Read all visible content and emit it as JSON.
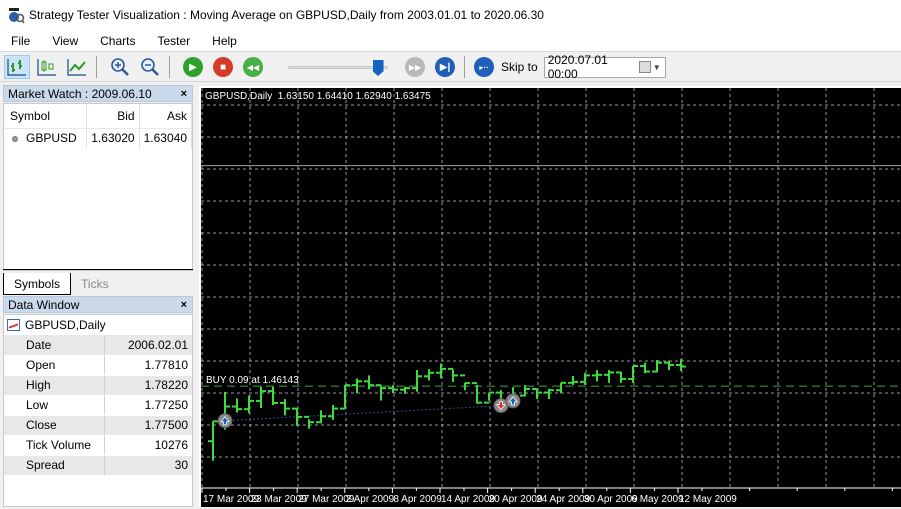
{
  "window": {
    "title": "Strategy Tester Visualization : Moving Average on GBPUSD,Daily from 2003.01.01 to 2020.06.30"
  },
  "menu": [
    {
      "label": "File"
    },
    {
      "label": "View"
    },
    {
      "label": "Charts"
    },
    {
      "label": "Tester"
    },
    {
      "label": "Help"
    }
  ],
  "toolbar": {
    "icons": [
      "bar-chart-icon",
      "candlestick-chart-icon",
      "line-chart-icon",
      "zoom-in-icon",
      "zoom-out-icon",
      "play-icon",
      "stop-icon",
      "rewind-icon",
      "fast-forward-icon",
      "skip-to-end-icon",
      "skip-to-icon"
    ],
    "speed_slider_value": 0.95,
    "skip_label": "Skip to",
    "skip_date": "2020.07.01 00:00"
  },
  "market_watch": {
    "title": "Market Watch : 2009.06.10",
    "columns": [
      "Symbol",
      "Bid",
      "Ask"
    ],
    "rows": [
      {
        "symbol": "GBPUSD",
        "bid": "1.63020",
        "ask": "1.63040"
      }
    ],
    "tabs": [
      {
        "label": "Symbols",
        "active": true
      },
      {
        "label": "Ticks",
        "active": false
      }
    ]
  },
  "data_window": {
    "title": "Data Window",
    "chart_name": "GBPUSD,Daily",
    "rows": [
      {
        "label": "Date",
        "value": "2006.02.01"
      },
      {
        "label": "Open",
        "value": "1.77810"
      },
      {
        "label": "High",
        "value": "1.78220"
      },
      {
        "label": "Low",
        "value": "1.77250"
      },
      {
        "label": "Close",
        "value": "1.77500"
      },
      {
        "label": "Tick Volume",
        "value": "10276"
      },
      {
        "label": "Spread",
        "value": "30"
      }
    ]
  },
  "chart": {
    "header": "GBPUSD,Daily  1.63150 1.64410 1.62940 1.63475",
    "buy_label": "BUY 0.09 at 1.46143",
    "colors": {
      "background": "#000000",
      "bars": "#3ddc3d",
      "grid": "#c0c0c0",
      "trade_line": "#3fa33f",
      "ma_line": "#2e4a8c",
      "buy_marker": "#1f5fb0",
      "sell_marker": "#e03030"
    }
  },
  "chart_data": {
    "type": "ohlc",
    "symbol": "GBPUSD",
    "timeframe": "Daily",
    "title": "GBPUSD,Daily",
    "ohlc_header": {
      "open": 1.6315,
      "high": 1.6441,
      "low": 1.6294,
      "close": 1.63475
    },
    "x_tick_labels": [
      "17 Mar 2009",
      "23 Mar 2009",
      "27 Mar 2009",
      "2 Apr 2009",
      "8 Apr 2009",
      "14 Apr 2009",
      "20 Apr 2009",
      "24 Apr 2009",
      "30 Apr 2009",
      "6 May 2009",
      "12 May 2009"
    ],
    "bars_per_tick": 4,
    "ylim": [
      1.427,
      1.562
    ],
    "grid": true,
    "horizontal_level": 1.5358,
    "trade_level": {
      "label": "BUY 0.09 at 1.46143",
      "price": 1.4614
    },
    "bars": [
      {
        "o": 1.4428,
        "h": 1.4495,
        "l": 1.4362,
        "c": 1.4495
      },
      {
        "o": 1.4495,
        "h": 1.4594,
        "l": 1.4467,
        "c": 1.4545
      },
      {
        "o": 1.4545,
        "h": 1.4572,
        "l": 1.4525,
        "c": 1.4536
      },
      {
        "o": 1.4536,
        "h": 1.4582,
        "l": 1.4522,
        "c": 1.4564
      },
      {
        "o": 1.4564,
        "h": 1.4612,
        "l": 1.454,
        "c": 1.4597
      },
      {
        "o": 1.4597,
        "h": 1.4612,
        "l": 1.455,
        "c": 1.4557
      },
      {
        "o": 1.4557,
        "h": 1.457,
        "l": 1.4515,
        "c": 1.4538
      },
      {
        "o": 1.4538,
        "h": 1.454,
        "l": 1.448,
        "c": 1.451
      },
      {
        "o": 1.451,
        "h": 1.4502,
        "l": 1.447,
        "c": 1.4492
      },
      {
        "o": 1.4492,
        "h": 1.4532,
        "l": 1.4488,
        "c": 1.4512
      },
      {
        "o": 1.4512,
        "h": 1.455,
        "l": 1.45,
        "c": 1.4538
      },
      {
        "o": 1.4538,
        "h": 1.4617,
        "l": 1.4537,
        "c": 1.4617
      },
      {
        "o": 1.4617,
        "h": 1.464,
        "l": 1.459,
        "c": 1.463
      },
      {
        "o": 1.463,
        "h": 1.465,
        "l": 1.4603,
        "c": 1.4617
      },
      {
        "o": 1.4617,
        "h": 1.4617,
        "l": 1.4565,
        "c": 1.4607
      },
      {
        "o": 1.4607,
        "h": 1.4617,
        "l": 1.459,
        "c": 1.4602
      },
      {
        "o": 1.4602,
        "h": 1.4612,
        "l": 1.4588,
        "c": 1.4607
      },
      {
        "o": 1.4607,
        "h": 1.4668,
        "l": 1.4595,
        "c": 1.4647
      },
      {
        "o": 1.4647,
        "h": 1.4671,
        "l": 1.4633,
        "c": 1.4659
      },
      {
        "o": 1.4659,
        "h": 1.469,
        "l": 1.464,
        "c": 1.4672
      },
      {
        "o": 1.4672,
        "h": 1.467,
        "l": 1.4628,
        "c": 1.465
      },
      {
        "o": 1.465,
        "h": 1.4625,
        "l": 1.46,
        "c": 1.4624
      },
      {
        "o": 1.4624,
        "h": 1.4618,
        "l": 1.4555,
        "c": 1.4558
      },
      {
        "o": 1.4558,
        "h": 1.4592,
        "l": 1.4565,
        "c": 1.4592
      },
      {
        "o": 1.4592,
        "h": 1.46,
        "l": 1.456,
        "c": 1.4565
      },
      {
        "o": 1.4565,
        "h": 1.461,
        "l": 1.4548,
        "c": 1.4582
      },
      {
        "o": 1.4582,
        "h": 1.4617,
        "l": 1.458,
        "c": 1.4604
      },
      {
        "o": 1.4604,
        "h": 1.4605,
        "l": 1.457,
        "c": 1.4592
      },
      {
        "o": 1.4592,
        "h": 1.4605,
        "l": 1.457,
        "c": 1.46
      },
      {
        "o": 1.46,
        "h": 1.4625,
        "l": 1.459,
        "c": 1.4625
      },
      {
        "o": 1.4625,
        "h": 1.4648,
        "l": 1.4618,
        "c": 1.4628
      },
      {
        "o": 1.4628,
        "h": 1.4658,
        "l": 1.4618,
        "c": 1.465
      },
      {
        "o": 1.465,
        "h": 1.4668,
        "l": 1.463,
        "c": 1.4652
      },
      {
        "o": 1.4652,
        "h": 1.4668,
        "l": 1.4625,
        "c": 1.466
      },
      {
        "o": 1.466,
        "h": 1.4662,
        "l": 1.4625,
        "c": 1.4638
      },
      {
        "o": 1.4638,
        "h": 1.4682,
        "l": 1.4625,
        "c": 1.4682
      },
      {
        "o": 1.4682,
        "h": 1.4693,
        "l": 1.4658,
        "c": 1.4663
      },
      {
        "o": 1.4663,
        "h": 1.4702,
        "l": 1.466,
        "c": 1.4693
      },
      {
        "o": 1.4693,
        "h": 1.47,
        "l": 1.4668,
        "c": 1.4685
      },
      {
        "o": 1.4685,
        "h": 1.4705,
        "l": 1.4665,
        "c": 1.468
      }
    ]
  }
}
